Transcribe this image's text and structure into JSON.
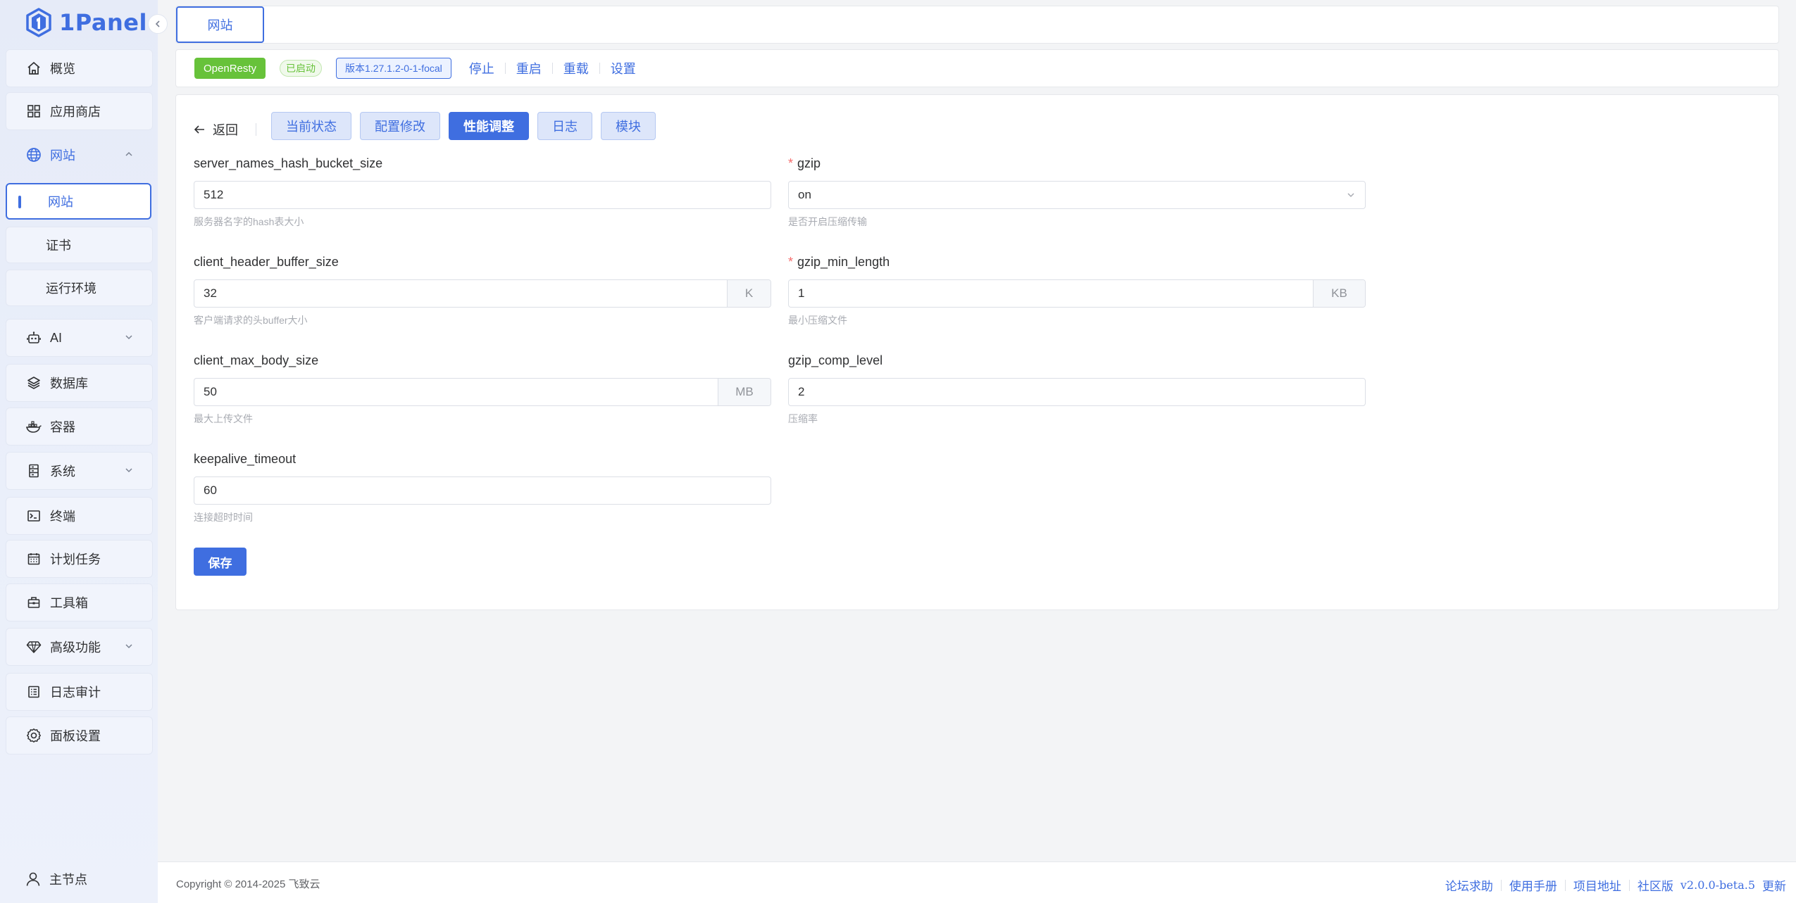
{
  "brand": {
    "name": "1Panel"
  },
  "sidebar": {
    "items": [
      {
        "label": "概览",
        "icon": "home-icon"
      },
      {
        "label": "应用商店",
        "icon": "grid-icon"
      },
      {
        "label": "网站",
        "icon": "globe-icon",
        "expanded": true,
        "children": [
          {
            "label": "网站",
            "active": true
          },
          {
            "label": "证书"
          },
          {
            "label": "运行环境"
          }
        ]
      },
      {
        "label": "AI",
        "icon": "robot-icon",
        "has_children": true
      },
      {
        "label": "数据库",
        "icon": "layers-icon"
      },
      {
        "label": "容器",
        "icon": "docker-icon"
      },
      {
        "label": "系统",
        "icon": "server-icon",
        "has_children": true
      },
      {
        "label": "终端",
        "icon": "terminal-icon"
      },
      {
        "label": "计划任务",
        "icon": "calendar-icon"
      },
      {
        "label": "工具箱",
        "icon": "toolbox-icon"
      },
      {
        "label": "高级功能",
        "icon": "diamond-icon",
        "has_children": true
      },
      {
        "label": "日志审计",
        "icon": "log-icon"
      },
      {
        "label": "面板设置",
        "icon": "gear-icon"
      }
    ],
    "node": {
      "label": "主节点",
      "icon": "user-icon"
    }
  },
  "topbar": {
    "tab": "网站"
  },
  "status": {
    "app": "OpenResty",
    "state": "已启动",
    "version": "版本1.27.1.2-0-1-focal",
    "actions": [
      "停止",
      "重启",
      "重载",
      "设置"
    ],
    "colors": {
      "running": "#67c23a",
      "accent": "#3f6ee0"
    }
  },
  "toolbar": {
    "back": "返回",
    "tabs": [
      {
        "label": "当前状态",
        "active": false
      },
      {
        "label": "配置修改",
        "active": false
      },
      {
        "label": "性能调整",
        "active": true
      },
      {
        "label": "日志",
        "active": false
      },
      {
        "label": "模块",
        "active": false
      }
    ]
  },
  "form": {
    "server_names_hash_bucket_size": {
      "label": "server_names_hash_bucket_size",
      "value": "512",
      "help": "服务器名字的hash表大小"
    },
    "client_header_buffer_size": {
      "label": "client_header_buffer_size",
      "value": "32",
      "unit": "K",
      "help": "客户端请求的头buffer大小"
    },
    "client_max_body_size": {
      "label": "client_max_body_size",
      "value": "50",
      "unit": "MB",
      "help": "最大上传文件"
    },
    "keepalive_timeout": {
      "label": "keepalive_timeout",
      "value": "60",
      "help": "连接超时时间"
    },
    "gzip": {
      "label": "gzip",
      "required": "*",
      "value": "on",
      "help": "是否开启压缩传输"
    },
    "gzip_min_length": {
      "label": "gzip_min_length",
      "required": "*",
      "value": "1",
      "unit": "KB",
      "help": "最小压缩文件"
    },
    "gzip_comp_level": {
      "label": "gzip_comp_level",
      "value": "2",
      "help": "压缩率"
    },
    "save": "保存"
  },
  "footer": {
    "copyright": "Copyright © 2014-2025 飞致云",
    "links": [
      "论坛求助",
      "使用手册",
      "项目地址",
      "社区版"
    ],
    "version": "v2.0.0-beta.5",
    "update": "更新"
  }
}
